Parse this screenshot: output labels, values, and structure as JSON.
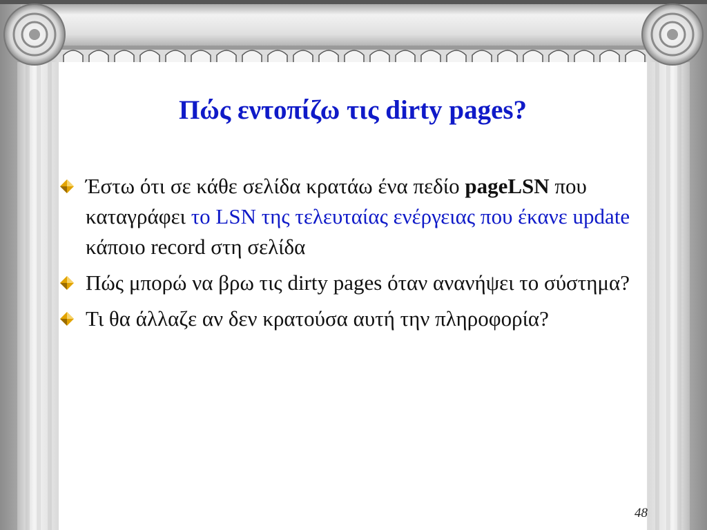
{
  "slide": {
    "title": "Πώς εντοπίζω τις dirty pages?",
    "bullets": [
      {
        "parts": [
          "Έστω ότι σε κάθε σελίδα κρατάω ένα πεδίο ",
          "pageLSN",
          " που καταγράφει ",
          "το LSN της τελευταίας ενέργειας που έκανε update",
          " κάποιο record στη σελίδα"
        ]
      },
      {
        "text": "Πώς μπορώ να βρω τις dirty pages όταν ανανήψει το σύστημα?"
      },
      {
        "text": "Τι θα άλλαζε αν δεν κρατούσα αυτή την πληροφορία?"
      }
    ],
    "page_number": "48"
  },
  "icons": {
    "bullet": "diamond-bullet-icon",
    "volutes": "ionic-volute-icon"
  },
  "colors": {
    "title": "#0f1ac8",
    "highlight": "#0f1ac8",
    "bullet_gold": "#e2a300"
  }
}
